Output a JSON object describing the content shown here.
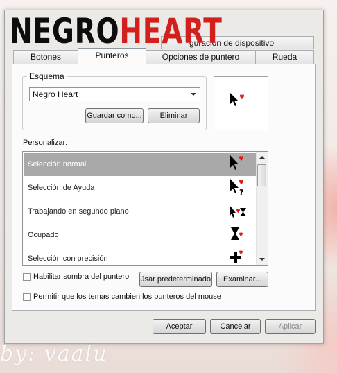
{
  "branding": {
    "logo_part1": "NEGRO",
    "logo_part2": "HEART"
  },
  "tabs_top": [
    "Botones",
    "Punteros",
    "Opciones de puntero",
    "Rueda"
  ],
  "tab_hardware_partial": "guración de dispositivo",
  "scheme": {
    "legend": "Esquema",
    "selected": "Negro Heart",
    "save_as": "Guardar como...",
    "delete": "Eliminar"
  },
  "customize": {
    "label": "Personalizar:",
    "items": [
      {
        "label": "Selección normal",
        "icon": "arrow-heart-cursor",
        "selected": true
      },
      {
        "label": "Selección de Ayuda",
        "icon": "help-heart-cursor",
        "selected": false
      },
      {
        "label": "Trabajando en segundo plano",
        "icon": "busy-arrow-heart-cursor",
        "selected": false
      },
      {
        "label": "Ocupado",
        "icon": "hourglass-heart-cursor",
        "selected": false
      },
      {
        "label": "Selección con precisión",
        "icon": "crosshair-heart-cursor",
        "selected": false
      }
    ]
  },
  "options": {
    "shadow": "Habilitar sombra del puntero",
    "use_default": "Jsar predeterminado",
    "browse": "Examinar...",
    "allow_themes": "Permitir que los temas cambien los punteros del mouse"
  },
  "footer": {
    "accept": "Aceptar",
    "cancel": "Cancelar",
    "apply": "Aplicar"
  },
  "watermark": "by: vaalu",
  "colors": {
    "accent_red": "#d3201c",
    "selection_gray": "#a9a9a9"
  }
}
